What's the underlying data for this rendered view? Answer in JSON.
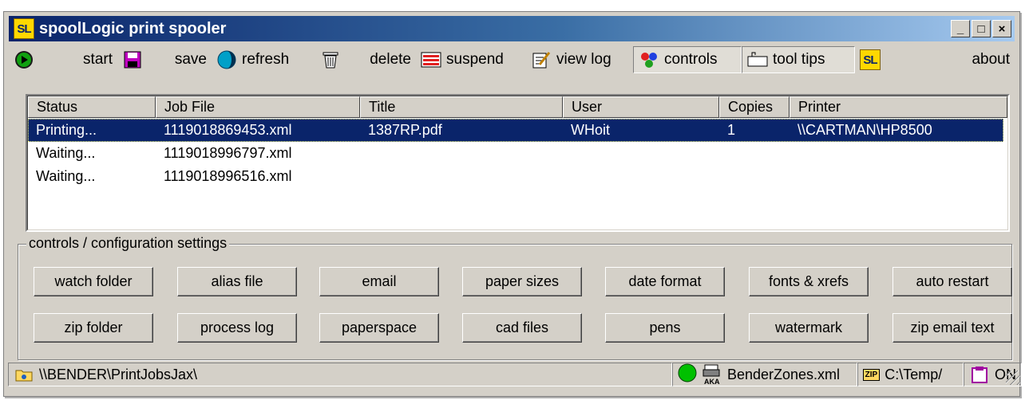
{
  "window": {
    "title": "spoolLogic print spooler",
    "logo_text": "SL",
    "buttons": {
      "minimize": "_",
      "maximize": "□",
      "close": "×"
    }
  },
  "toolbar": {
    "start": "start",
    "save": "save",
    "refresh": "refresh",
    "delete": "delete",
    "suspend": "suspend",
    "view_log": "view log",
    "controls": "controls",
    "tool_tips": "tool tips",
    "about": "about",
    "about_logo": "SL"
  },
  "jobs": {
    "columns": [
      "Status",
      "Job File",
      "Title",
      "User",
      "Copies",
      "Printer"
    ],
    "rows": [
      {
        "status": "Printing...",
        "job_file": "1119018869453.xml",
        "title": "1387RP.pdf",
        "user": "WHoit",
        "copies": "1",
        "printer": "\\\\CARTMAN\\HP8500"
      },
      {
        "status": "Waiting...",
        "job_file": "1119018996797.xml",
        "title": "",
        "user": "",
        "copies": "",
        "printer": ""
      },
      {
        "status": "Waiting...",
        "job_file": "1119018996516.xml",
        "title": "",
        "user": "",
        "copies": "",
        "printer": ""
      }
    ]
  },
  "controls": {
    "legend": "controls / configuration settings",
    "row1": [
      "watch folder",
      "alias file",
      "email",
      "paper sizes",
      "date format",
      "fonts & xrefs",
      "auto restart"
    ],
    "row2": [
      "zip folder",
      "process log",
      "paperspace",
      "cad files",
      "pens",
      "watermark",
      "zip email text"
    ]
  },
  "status": {
    "path": "\\\\BENDER\\PrintJobsJax\\",
    "zones": "BenderZones.xml",
    "zip_path": "C:\\Temp/",
    "state": "ON",
    "aka_label": "AKA",
    "zip_label": "ZIP"
  },
  "colors": {
    "selection": "#0a246a",
    "status_light": "#00c000",
    "title_gradient_start": "#0a246a"
  }
}
